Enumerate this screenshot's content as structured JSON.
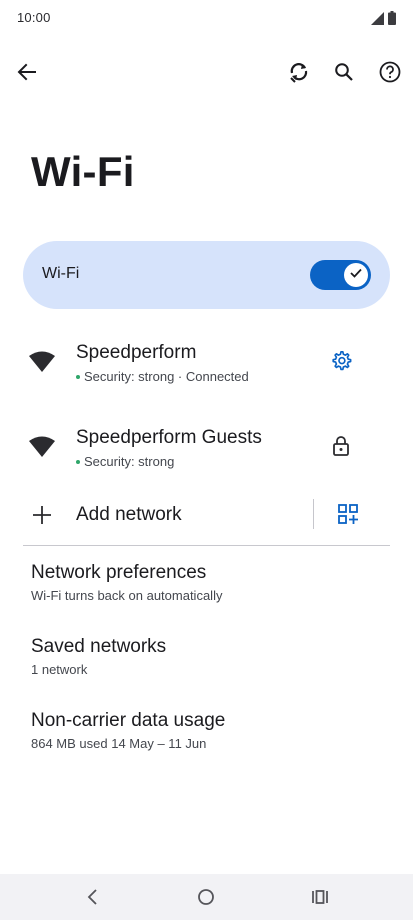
{
  "status_bar": {
    "time": "10:00",
    "icons": [
      "signal-icon",
      "battery-icon"
    ]
  },
  "app_bar": {
    "icons": [
      "back-arrow-icon",
      "sync-icon",
      "search-icon",
      "help-icon"
    ]
  },
  "page": {
    "title": "Wi-Fi"
  },
  "master_switch": {
    "label": "Wi-Fi",
    "state": "on",
    "accent_color": "#0b63c5",
    "card_color": "#d6e3fb"
  },
  "networks": [
    {
      "name": "Speedperform",
      "status": "Security: strong · Connected",
      "action_icon": "gear-icon"
    },
    {
      "name": "Speedperform Guests",
      "status": "Security: strong",
      "action_icon": "lock-icon"
    }
  ],
  "add_network": {
    "label": "Add network",
    "icon": "plus-icon",
    "qr_icon": "qr-code-scan-icon"
  },
  "settings": [
    {
      "title": "Network preferences",
      "subtitle": "Wi-Fi turns back on automatically"
    },
    {
      "title": "Saved networks",
      "subtitle": "1 network"
    },
    {
      "title": "Non-carrier data usage",
      "subtitle": "864 MB used 14 May – 11 Jun"
    }
  ],
  "nav_bar": {
    "icons": [
      "nav-back-icon",
      "nav-home-icon",
      "nav-recents-icon"
    ]
  }
}
